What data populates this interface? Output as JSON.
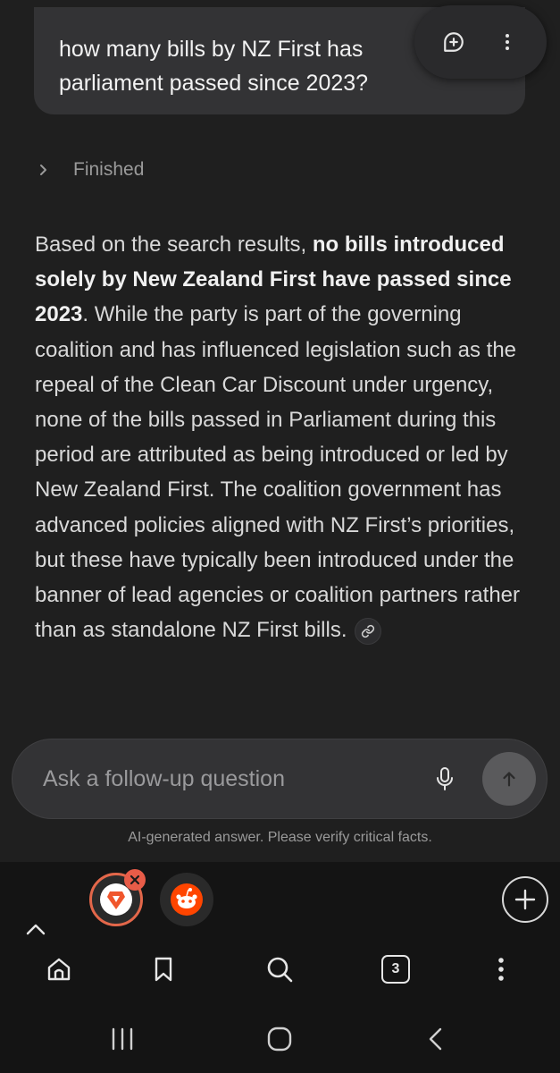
{
  "question": {
    "text": "how many bills by NZ First has parliament passed since 2023?"
  },
  "bubble_actions": {
    "new_thread_icon": "chat-plus-icon",
    "more_icon": "more-vertical-icon"
  },
  "status": {
    "label": "Finished"
  },
  "answer": {
    "intro": "Based on the search results, ",
    "bold": "no bills introduced solely by New Zealand First have passed since 2023",
    "rest": ". While the party is part of the governing coalition and has influenced legislation such as the repeal of the Clean Car Discount under urgency, none of the bills passed in Parliament during this period are attributed as being introduced or led by New Zealand First. The coalition government has advanced policies aligned with NZ First’s priorities, but these have typically been introduced under the banner of lead agencies or coalition partners rather than as standalone NZ First bills."
  },
  "followup": {
    "placeholder": "Ask a follow-up question"
  },
  "disclaimer": "AI-generated answer. Please verify critical facts.",
  "tabs": {
    "count": "3"
  },
  "colors": {
    "background": "#1f1f1f",
    "bubble": "#333335",
    "accent": "#e3674a",
    "chrome": "#141414"
  }
}
